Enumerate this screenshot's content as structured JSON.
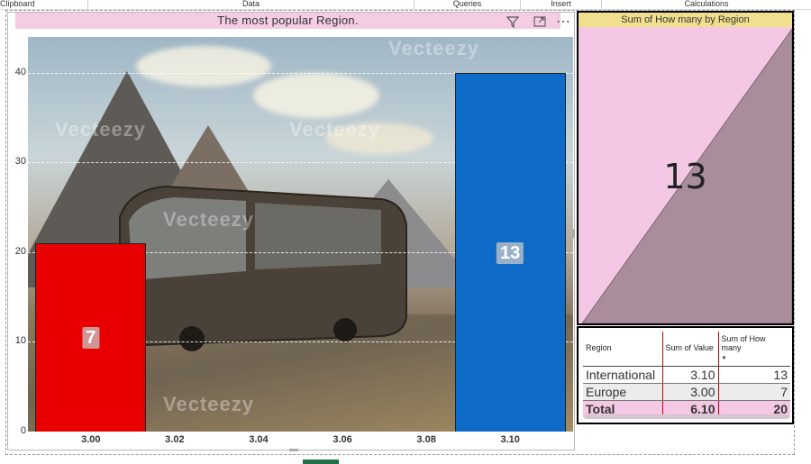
{
  "ribbon": {
    "groups": [
      "Clipboard",
      "Data",
      "Queries",
      "Insert",
      "Calculations"
    ]
  },
  "bar_visual": {
    "title": "The most popular Region.",
    "bar_labels": [
      "7",
      "13"
    ],
    "bar_colors": [
      "#e80000",
      "#0f6bc8"
    ],
    "watermark": "Vecteezy"
  },
  "chart_data": {
    "type": "bar",
    "title": "The most popular Region.",
    "x": [
      3.0,
      3.1
    ],
    "x_ticks": [
      "3.00",
      "3.02",
      "3.04",
      "3.06",
      "3.08",
      "3.10"
    ],
    "values": [
      21,
      40
    ],
    "data_labels": [
      "7",
      "13"
    ],
    "colors": [
      "#e80000",
      "#0f6bc8"
    ],
    "y_ticks": [
      "0",
      "10",
      "20",
      "30",
      "40"
    ],
    "xlim": [
      2.985,
      3.115
    ],
    "ylim": [
      0,
      44
    ],
    "grid": true
  },
  "card": {
    "title": "Sum of How many by Region",
    "value": "13"
  },
  "table": {
    "headers": [
      "Region",
      "Sum of Value",
      "Sum of How many"
    ],
    "rows": [
      {
        "region": "International",
        "value": "3.10",
        "how_many": "13"
      },
      {
        "region": "Europe",
        "value": "3.00",
        "how_many": "7"
      }
    ],
    "total": {
      "label": "Total",
      "value": "6.10",
      "how_many": "20"
    }
  },
  "icons": {
    "filter": "filter-icon",
    "focus": "focus-mode-icon",
    "more": "more-options-icon"
  }
}
